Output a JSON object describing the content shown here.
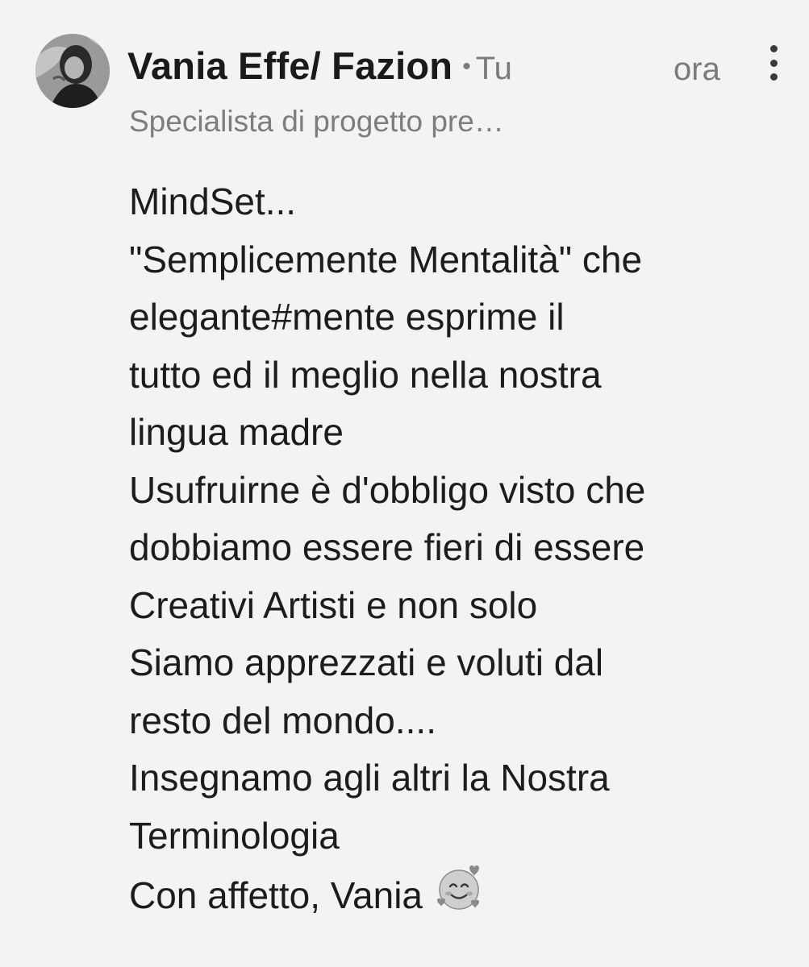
{
  "comment": {
    "author": {
      "name": "Vania Effe/ Fazion",
      "relation": "Tu",
      "separator": "•",
      "headline": "Specialista di progetto pre…"
    },
    "timestamp": "ora",
    "body_lines": [
      "MindSet...",
      "\"Semplicemente Mentalità\" che",
      "elegante#mente esprime il",
      "tutto ed il meglio nella nostra",
      "lingua madre",
      "Usufruirne è d'obbligo visto che",
      "dobbiamo essere fieri di essere",
      "Creativi Artisti e non solo",
      "Siamo apprezzati e voluti dal",
      "resto del mondo....",
      "Insegnamo agli altri la Nostra",
      "Terminologia",
      "Con affetto, Vania"
    ],
    "emoji": "smiling-face-with-hearts-icon"
  },
  "colors": {
    "background": "#f3f3f3",
    "text_primary": "#1c1c1c",
    "text_secondary": "#7a7a7a"
  }
}
